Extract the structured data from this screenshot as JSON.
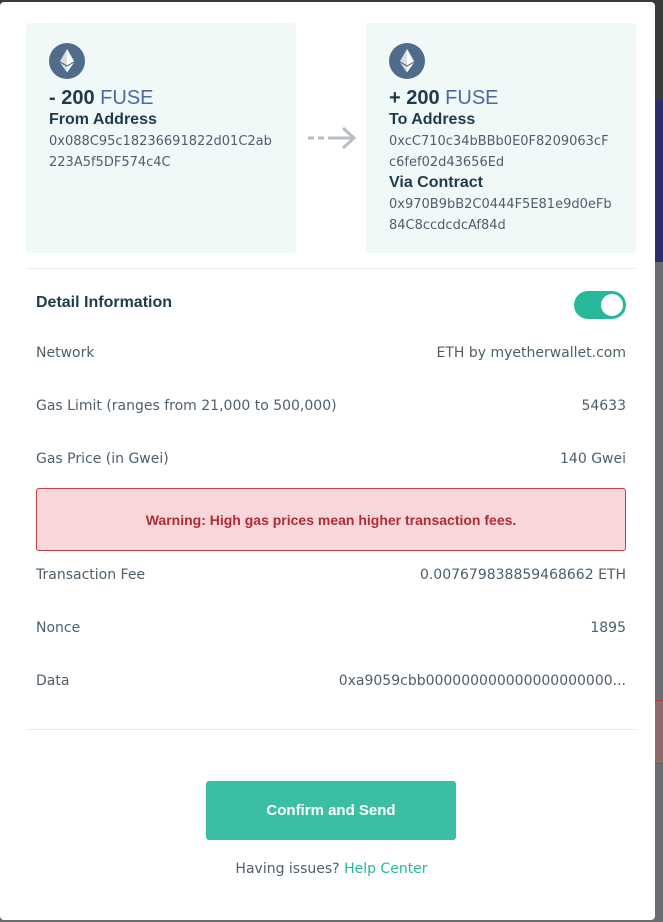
{
  "from": {
    "amount": "- 200",
    "symbol": "FUSE",
    "label": "From Address",
    "address": "0x088C95c18236691822d01C2ab223A5f5DF574c4C"
  },
  "to": {
    "amount": "+ 200",
    "symbol": "FUSE",
    "label": "To Address",
    "address": "0xcC710c34bBBb0E0F8209063cFc6fef02d43656Ed",
    "contract_label": "Via Contract",
    "contract_address": "0x970B9bB2C0444F5E81e9d0eFb84C8ccdcdcAf84d"
  },
  "details": {
    "title": "Detail Information",
    "toggle_on": true,
    "network_label": "Network",
    "network_value": "ETH by myetherwallet.com",
    "gas_limit_label": "Gas Limit (ranges from 21,000 to 500,000)",
    "gas_limit_value": "54633",
    "gas_price_label": "Gas Price (in Gwei)",
    "gas_price_value": "140 Gwei",
    "warning": "Warning: High gas prices mean higher transaction fees.",
    "fee_label": "Transaction Fee",
    "fee_value": "0.007679838859468662 ETH",
    "nonce_label": "Nonce",
    "nonce_value": "1895",
    "data_label": "Data",
    "data_value": "0xa9059cbb000000000000000000000..."
  },
  "actions": {
    "confirm_label": "Confirm and Send",
    "help_prefix": "Having issues?",
    "help_link": "Help Center"
  },
  "colors": {
    "accent": "#3bbfa4",
    "card_bg": "#f1f8f8",
    "warning_bg": "#f8d7da",
    "warning_text": "#b12a35"
  },
  "icons": {
    "token": "ethereum-icon",
    "transfer": "arrow-right-icon"
  }
}
